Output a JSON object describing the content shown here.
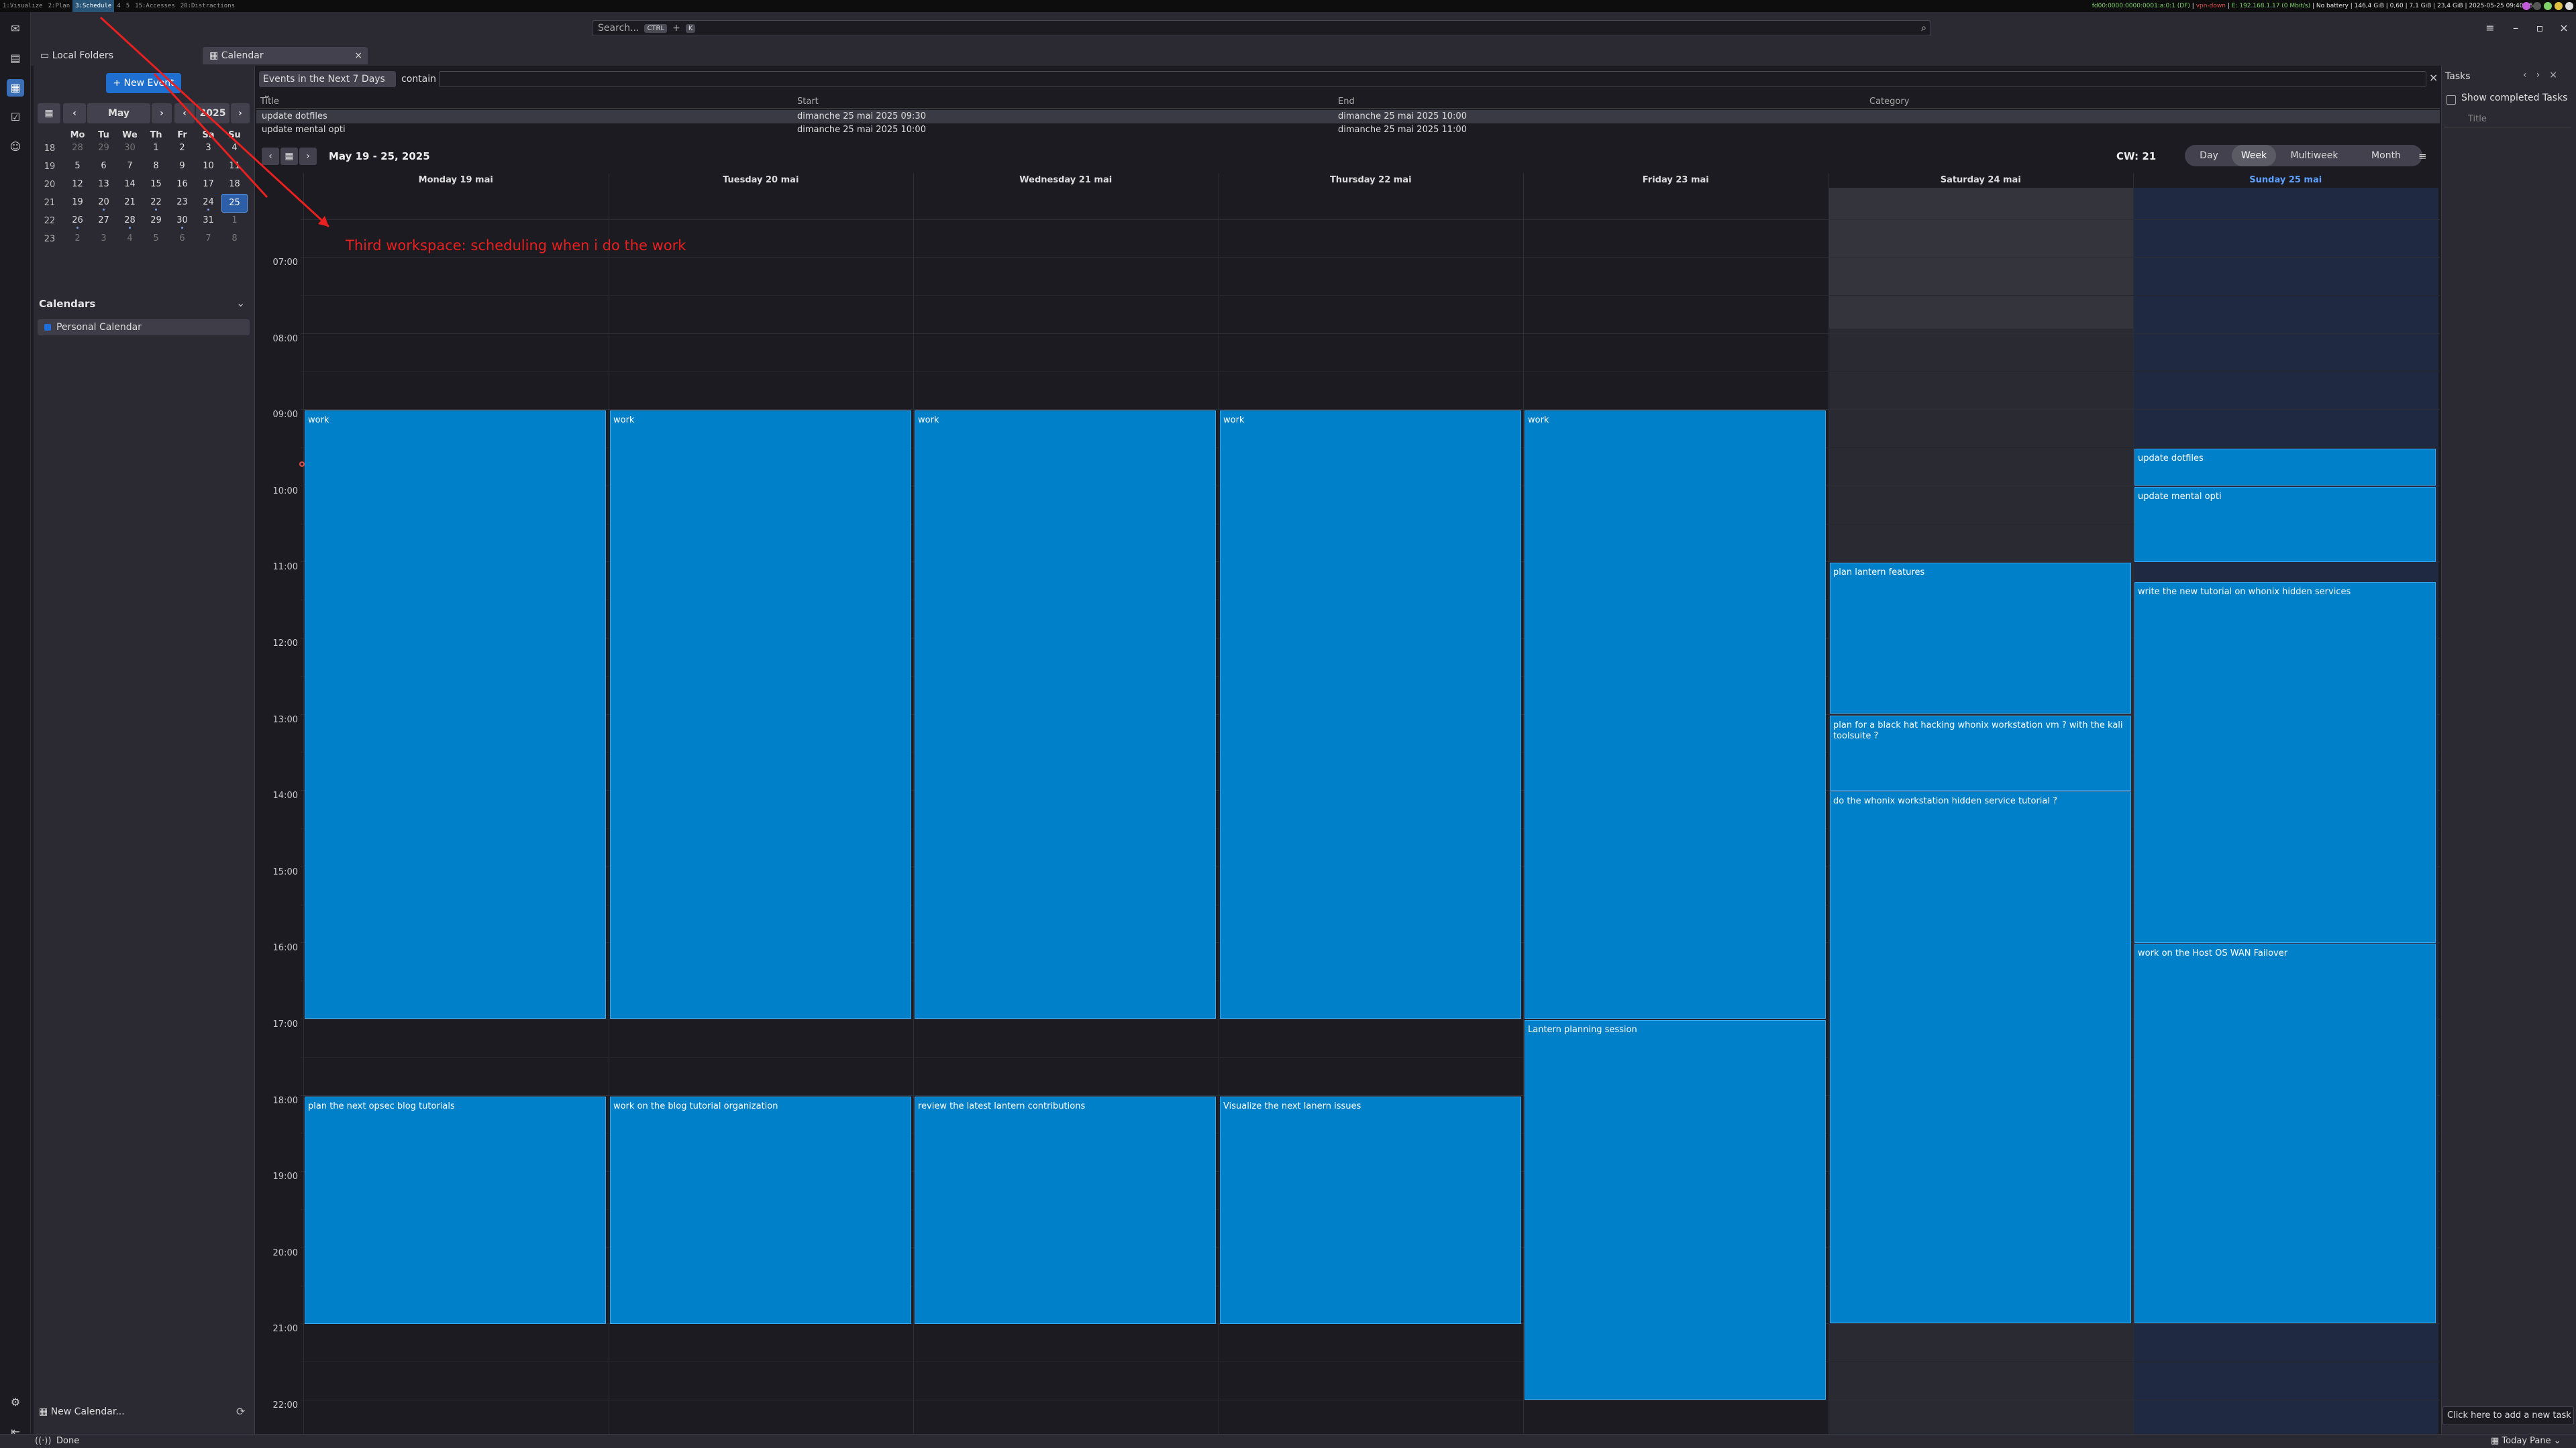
{
  "topbar": {
    "workspaces": [
      "1:Visualize",
      "2:Plan",
      "3:Schedule",
      "4",
      "5",
      "15:Accesses",
      "20:Distractions"
    ],
    "active_workspace": 2,
    "ipv6": "fd00:0000:0000:0001:a:0:1 (DF)",
    "vpn": "vpn-down",
    "net": "E: 192.168.1.17 (0 Mbit/s)",
    "battery": "No battery",
    "disk": "146,4 GiB",
    "load": "0,60",
    "mem": "7,1 GiB",
    "swap": "23,4 GiB",
    "datetime": "2025-05-25 09:40:45"
  },
  "search": {
    "placeholder": "Search...",
    "kbd1": "CTRL",
    "plus": "+",
    "kbd2": "K"
  },
  "tabs": [
    {
      "label": "Local Folders"
    },
    {
      "label": "Calendar"
    }
  ],
  "sidebar": {
    "new_event": "New Event",
    "mini_month": {
      "month": "May",
      "year": "2025",
      "dow": [
        "Mo",
        "Tu",
        "We",
        "Th",
        "Fr",
        "Sa",
        "Su"
      ]
    },
    "calendars_heading": "Calendars",
    "personal_calendar": "Personal Calendar",
    "new_calendar": "New Calendar..."
  },
  "filter": {
    "select": "Events in the Next 7 Days",
    "contain": "contain"
  },
  "list": {
    "headers": [
      "Title",
      "Start",
      "End",
      "Category"
    ],
    "rows": [
      {
        "title": "update dotfiles",
        "start": "dimanche 25 mai 2025 09:30",
        "end": "dimanche 25 mai 2025 10:00"
      },
      {
        "title": "update mental opti",
        "start": "dimanche 25 mai 2025 10:00",
        "end": "dimanche 25 mai 2025 11:00"
      }
    ]
  },
  "week": {
    "range": "May 19 - 25, 2025",
    "cw": "CW: 21",
    "views": [
      "Day",
      "Week",
      "Multiweek",
      "Month"
    ],
    "active_view": 1,
    "days": [
      "Monday 19 mai",
      "Tuesday 20 mai",
      "Wednesday 21 mai",
      "Thursday 22 mai",
      "Friday 23 mai",
      "Saturday 24 mai",
      "Sunday 25 mai"
    ],
    "hours": [
      "07:00",
      "08:00",
      "09:00",
      "10:00",
      "11:00",
      "12:00",
      "13:00",
      "14:00",
      "15:00",
      "16:00",
      "17:00",
      "18:00",
      "19:00",
      "20:00",
      "21:00",
      "22:00"
    ]
  },
  "events": [
    {
      "day": 0,
      "start": 9,
      "end": 17,
      "title": "work"
    },
    {
      "day": 1,
      "start": 9,
      "end": 17,
      "title": "work"
    },
    {
      "day": 2,
      "start": 9,
      "end": 17,
      "title": "work"
    },
    {
      "day": 3,
      "start": 9,
      "end": 17,
      "title": "work"
    },
    {
      "day": 4,
      "start": 9,
      "end": 17,
      "title": "work"
    },
    {
      "day": 0,
      "start": 18,
      "end": 21,
      "title": "plan the next opsec blog tutorials"
    },
    {
      "day": 1,
      "start": 18,
      "end": 21,
      "title": "work on the blog tutorial organization"
    },
    {
      "day": 2,
      "start": 18,
      "end": 21,
      "title": "review the latest lantern contributions"
    },
    {
      "day": 3,
      "start": 18,
      "end": 21,
      "title": "Visualize the next lanern issues"
    },
    {
      "day": 4,
      "start": 17,
      "end": 22,
      "title": "Lantern planning session"
    },
    {
      "day": 5,
      "start": 11,
      "end": 13,
      "title": "plan lantern features"
    },
    {
      "day": 5,
      "start": 13,
      "end": 14,
      "title": "plan for a black hat hacking whonix workstation vm ? with the kali toolsuite ?"
    },
    {
      "day": 5,
      "start": 14,
      "end": 21,
      "title": "do the whonix workstation hidden service tutorial ?"
    },
    {
      "day": 6,
      "start": 9.5,
      "end": 10,
      "title": "update dotfiles"
    },
    {
      "day": 6,
      "start": 10,
      "end": 11,
      "title": "update mental opti"
    },
    {
      "day": 6,
      "start": 11.25,
      "end": 16,
      "title": "write the new tutorial on whonix hidden services"
    },
    {
      "day": 6,
      "start": 16,
      "end": 21,
      "title": "work on the Host OS WAN Failover"
    }
  ],
  "annotation": "Third workspace: scheduling when i do the work",
  "tasks": {
    "title": "Tasks",
    "show_completed": "Show completed Tasks",
    "col_title": "Title",
    "add": "Click here to add a new task"
  },
  "statusbar": {
    "done": "Done",
    "today_pane": "Today Pane"
  },
  "colors": {
    "accent": "#1f6fd1",
    "event": "#0080c8",
    "annotation": "#e8201f"
  }
}
